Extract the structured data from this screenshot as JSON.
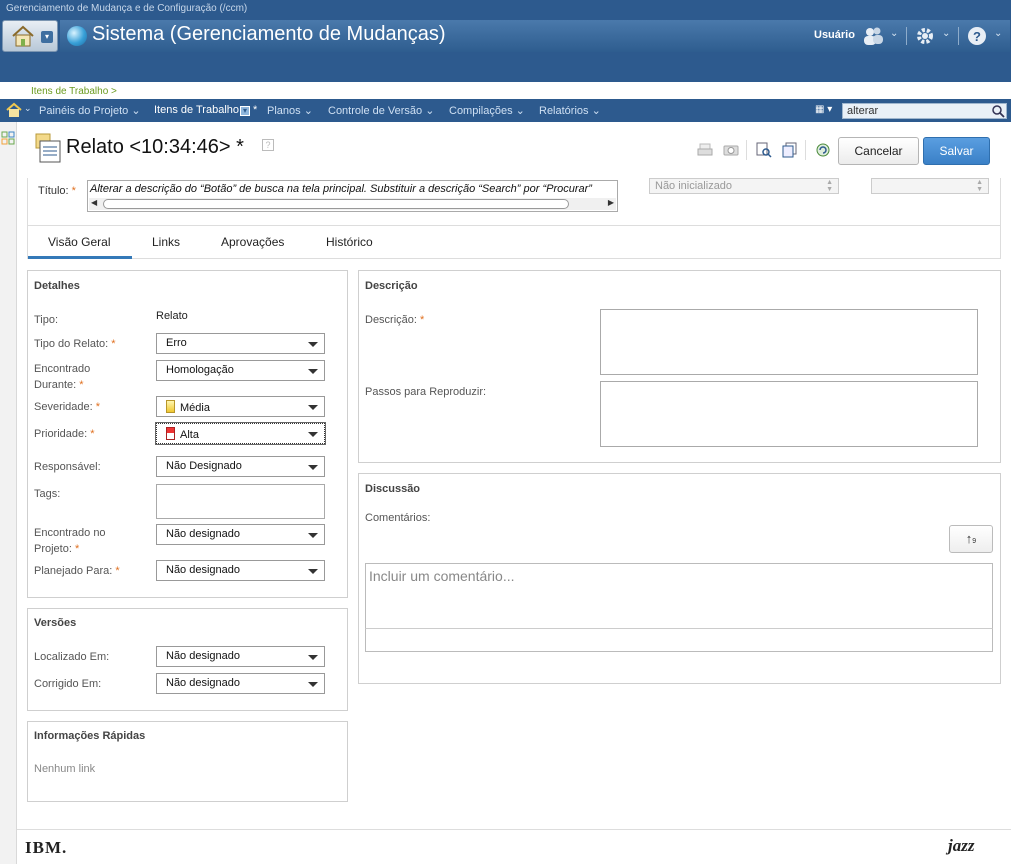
{
  "app": {
    "caption": "Gerenciamento de Mudança e de Configuração (/ccm)",
    "title": "Sistema (Gerenciamento de Mudanças)",
    "user_label": "Usuário"
  },
  "breadcrumb": "Itens de Trabalho >",
  "nav": {
    "items": [
      {
        "label": "Painéis do Projeto ⌄"
      },
      {
        "label": "Itens de Trabalho"
      },
      {
        "label": "Planos ⌄"
      },
      {
        "label": "Controle de Versão ⌄"
      },
      {
        "label": "Compilações ⌄"
      },
      {
        "label": "Relatórios ⌄"
      }
    ],
    "dirty_marker": "*",
    "search_value": "alterar"
  },
  "work_item": {
    "title": "Relato <10:34:46> *",
    "title_field_label": "Título:",
    "title_value": "Alterar a descrição do “Botão” de busca na tela principal. Substituir a descrição “Search” por “Procurar”",
    "status": "Não inicializado",
    "resolution": ""
  },
  "toolbar": {
    "cancel_label": "Cancelar",
    "save_label": "Salvar"
  },
  "tabs": [
    {
      "label": "Visão Geral"
    },
    {
      "label": "Links"
    },
    {
      "label": "Aprovações"
    },
    {
      "label": "Histórico"
    }
  ],
  "details": {
    "title": "Detalhes",
    "tipo_label": "Tipo:",
    "tipo_value": "Relato",
    "tipo_relato_label": "Tipo do Relato:",
    "tipo_relato_value": "Erro",
    "encontrado_durante_label_1": "Encontrado",
    "encontrado_durante_label_2": "Durante:",
    "encontrado_durante_value": "Homologação",
    "severidade_label": "Severidade:",
    "severidade_value": "Média",
    "prioridade_label": "Prioridade:",
    "prioridade_value": "Alta",
    "responsavel_label": "Responsável:",
    "responsavel_value": "Não Designado",
    "tags_label": "Tags:",
    "encontrado_projeto_label_1": "Encontrado no",
    "encontrado_projeto_label_2": "Projeto:",
    "encontrado_projeto_value": "Não designado",
    "planejado_label": "Planejado Para:",
    "planejado_value": "Não designado"
  },
  "versions": {
    "title": "Versões",
    "localizado_label": "Localizado Em:",
    "localizado_value": "Não designado",
    "corrigido_label": "Corrigido Em:",
    "corrigido_value": "Não designado"
  },
  "quick_info": {
    "title": "Informações Rápidas",
    "empty": "Nenhum link"
  },
  "description": {
    "title": "Descrição",
    "descricao_label": "Descrição:",
    "passos_label": "Passos para Reproduzir:"
  },
  "discussion": {
    "title": "Discussão",
    "comments_label": "Comentários:",
    "comment_placeholder": "Incluir um comentário..."
  },
  "footer": {
    "ibm": "IBM.",
    "jazz": "jazz"
  },
  "colors": {
    "banner": "#2d5a8e",
    "accent": "#3479b8",
    "required": "#e07020",
    "save_button": "#3a80c7"
  }
}
